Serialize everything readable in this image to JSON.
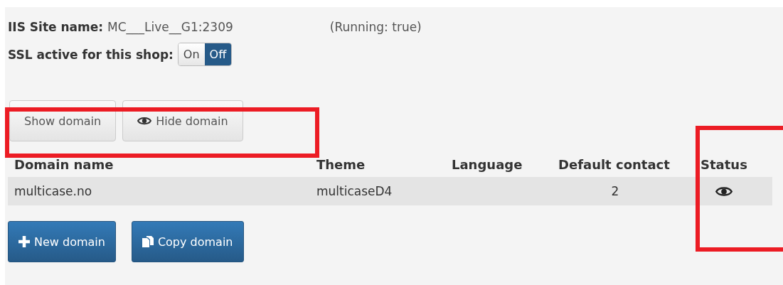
{
  "site": {
    "label": "IIS Site name:",
    "value": "MC___Live__G1:2309",
    "running": "(Running: true)"
  },
  "ssl": {
    "label": "SSL active for this shop:",
    "options": [
      {
        "label": "On",
        "selected": false
      },
      {
        "label": "Off",
        "selected": true
      }
    ]
  },
  "toggle_buttons": [
    {
      "label": "Show domain",
      "icon": false
    },
    {
      "label": "Hide domain",
      "icon": true
    }
  ],
  "table": {
    "columns": [
      "Domain name",
      "Theme",
      "Language",
      "Default contact",
      "Status"
    ],
    "rows": [
      {
        "domain": "multicase.no",
        "theme": "multicaseD4",
        "language": "",
        "default_contact": "2",
        "status_visible": true
      }
    ]
  },
  "actions": [
    {
      "label": "New domain",
      "kind": "new"
    },
    {
      "label": "Copy domain",
      "kind": "copy"
    }
  ]
}
